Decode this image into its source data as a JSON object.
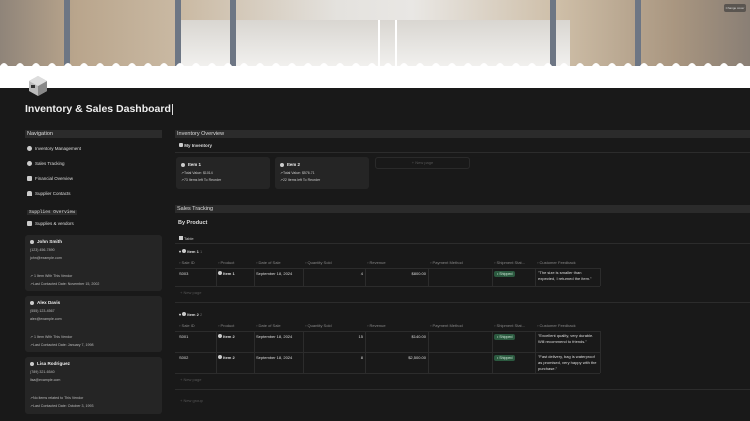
{
  "cover": {
    "button": "Change cover"
  },
  "title": "Inventory & Sales Dashboard",
  "navigation": {
    "header": "Navigation",
    "items": [
      "Inventory Management",
      "Sales Tracking",
      "Financial Overview",
      "Supplier Contacts"
    ]
  },
  "suppliers": {
    "header": "Supplies Overview",
    "link": "Supplies & vendors",
    "cards": [
      {
        "name": "John Smith",
        "phone": "(123) 456-7890",
        "email": "john@example.com",
        "items": "1 Item With This Vendor",
        "contacted": "Last Contacted Date: November 15, 2002"
      },
      {
        "name": "Alex Davis",
        "phone": "(555) 123-4567",
        "email": "alex@example.com",
        "items": "1 Item With This Vendor",
        "contacted": "Last Contacted Date: January 7, 1998"
      },
      {
        "name": "Lisa Rodriguez",
        "phone": "(789) 321-6540",
        "email": "lisa@example.com",
        "items": "No items related to This Vendor",
        "contacted": "Last Contacted Date: October 3, 1993"
      }
    ]
  },
  "inventory": {
    "header": "Inventory  Overview",
    "view": "My Inventory",
    "new_page": "+ New page",
    "items": [
      {
        "name": "Item 1",
        "value": "Total Value: $1014",
        "reorder": "73 Items left To Reorder"
      },
      {
        "name": "Item 2",
        "value": "Total Value: $576.71",
        "reorder": "22 Items left To Reorder"
      }
    ]
  },
  "sales": {
    "header": "Sales Tracking",
    "subheader": "By Product",
    "view": "Table",
    "columns": [
      "Sale ID",
      "Product",
      "Date of Sale",
      "Quantity Sold",
      "Revenue",
      "Payment Method",
      "Shipment Stat...",
      "Customer Feedback"
    ],
    "groups": [
      {
        "name": "Item 1",
        "count": "1",
        "rows": [
          {
            "id": "S003",
            "product": "Item 1",
            "date": "September 18, 2024",
            "qty": "4",
            "revenue": "$800.00",
            "status": "Shipped",
            "feedback": "\"The size is smaller than expected, I returned the item.\""
          }
        ]
      },
      {
        "name": "Item 2",
        "count": "2",
        "rows": [
          {
            "id": "S001",
            "product": "Item 2",
            "date": "September 18, 2024",
            "qty": "15",
            "revenue": "$140.00",
            "status": "Shipped",
            "feedback": "\"Excellent quality, very durable. Will recommend to friends.\""
          },
          {
            "id": "S002",
            "product": "Item 2",
            "date": "September 18, 2024",
            "qty": "8",
            "revenue": "$2,500.00",
            "status": "Shipped",
            "feedback": "\"Fast delivery, bag is waterproof as promised, very happy with the purchase.\""
          }
        ]
      }
    ],
    "new_page": "+ New page",
    "new_group": "+ New group"
  },
  "colors": {
    "background": "#191919",
    "badge": "#2b593f"
  }
}
